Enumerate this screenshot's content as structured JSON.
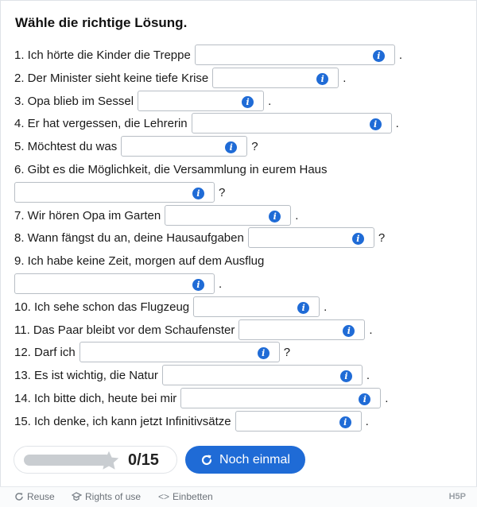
{
  "task": "Wähle die richtige Lösung.",
  "questions": [
    {
      "pre": "1. Ich hörte die Kinder die Treppe",
      "post": "."
    },
    {
      "pre": "2. Der Minister sieht keine tiefe Krise",
      "post": "."
    },
    {
      "pre": "3. Opa blieb im Sessel",
      "post": "."
    },
    {
      "pre": "4. Er hat vergessen, die Lehrerin",
      "post": "."
    },
    {
      "pre": "5. Möchtest du was",
      "post": "?"
    },
    {
      "pre": "6. Gibt es die Möglichkeit, die Versammlung in eurem Haus",
      "post": "?"
    },
    {
      "pre": "7. Wir hören Opa im Garten",
      "post": "."
    },
    {
      "pre": "8. Wann fängst du an, deine Hausaufgaben",
      "post": "?"
    },
    {
      "pre": "9. Ich habe keine Zeit, morgen auf dem Ausflug",
      "post": "."
    },
    {
      "pre": "10. Ich sehe schon das Flugzeug",
      "post": "."
    },
    {
      "pre": "11. Das Paar bleibt vor dem Schaufenster",
      "post": "."
    },
    {
      "pre": "12. Darf ich",
      "post": "?"
    },
    {
      "pre": "13. Es ist wichtig, die Natur",
      "post": "."
    },
    {
      "pre": "14. Ich bitte dich, heute bei mir",
      "post": "."
    },
    {
      "pre": "15. Ich denke, ich kann jetzt Infinitivsätze",
      "post": "."
    }
  ],
  "info_icon": "info-icon",
  "score": {
    "value": "0",
    "separator": "/",
    "max": "15",
    "progress": 0
  },
  "retry_button": {
    "label": "Noch einmal",
    "icon": "retry-icon"
  },
  "footer": {
    "reuse": "Reuse",
    "rights": "Rights of use",
    "embed": "Einbetten",
    "logo": "H5P"
  },
  "colors": {
    "accent": "#1f6bd6",
    "bar_track": "#c9cdd1",
    "star": "#c9cdd1"
  }
}
